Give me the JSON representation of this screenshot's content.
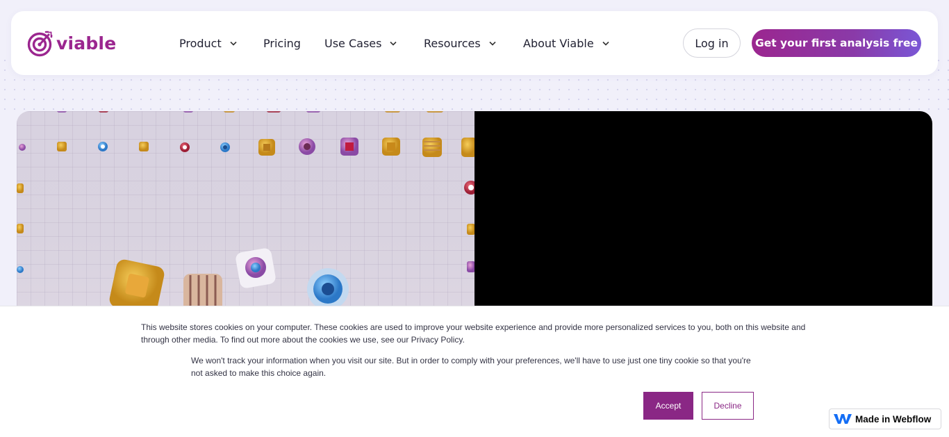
{
  "brand": {
    "name": "viable",
    "color": "#9b268f",
    "logo_icon": "target-arrow-icon"
  },
  "nav": {
    "items": [
      {
        "label": "Product",
        "has_dropdown": true
      },
      {
        "label": "Pricing",
        "has_dropdown": false
      },
      {
        "label": "Use Cases",
        "has_dropdown": true
      },
      {
        "label": "Resources",
        "has_dropdown": true
      },
      {
        "label": "About Viable",
        "has_dropdown": true
      }
    ],
    "login_label": "Log in",
    "cta_label": "Get your first analysis free"
  },
  "hero": {
    "video_background": "#000000"
  },
  "cookie_banner": {
    "text_primary": "This website stores cookies on your computer. These cookies are used to improve your website experience and provide more personalized services to you, both on this website and through other media. To find out more about the cookies we use, see our Privacy Policy.",
    "text_secondary": "We won't track your information when you visit our site. But in order to comply with your preferences, we'll have to use just one tiny cookie so that you're not asked to make this choice again.",
    "accept_label": "Accept",
    "decline_label": "Decline",
    "accent": "#8a2785"
  },
  "badge": {
    "label": "Made in Webflow",
    "icon": "webflow-icon"
  }
}
